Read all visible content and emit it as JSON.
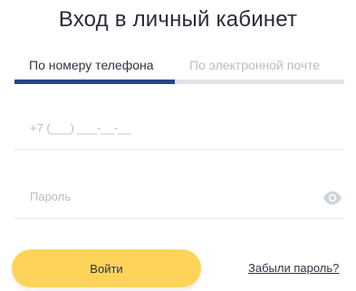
{
  "header": {
    "title": "Вход в личный кабинет"
  },
  "tabs": {
    "items": [
      {
        "label": "По номеру телефона",
        "active": true
      },
      {
        "label": "По электронной почте",
        "active": false
      }
    ]
  },
  "form": {
    "phone": {
      "value": "",
      "placeholder": "+7 (___) ___-__-__"
    },
    "password": {
      "value": "",
      "placeholder": "Пароль",
      "toggle_icon": "eye-icon"
    },
    "submit_label": "Войти",
    "forgot_label": "Забыли пароль?"
  },
  "colors": {
    "accent": "#25448b",
    "button": "#fdd459",
    "text": "#2e3442",
    "muted": "#b7bcc6"
  }
}
